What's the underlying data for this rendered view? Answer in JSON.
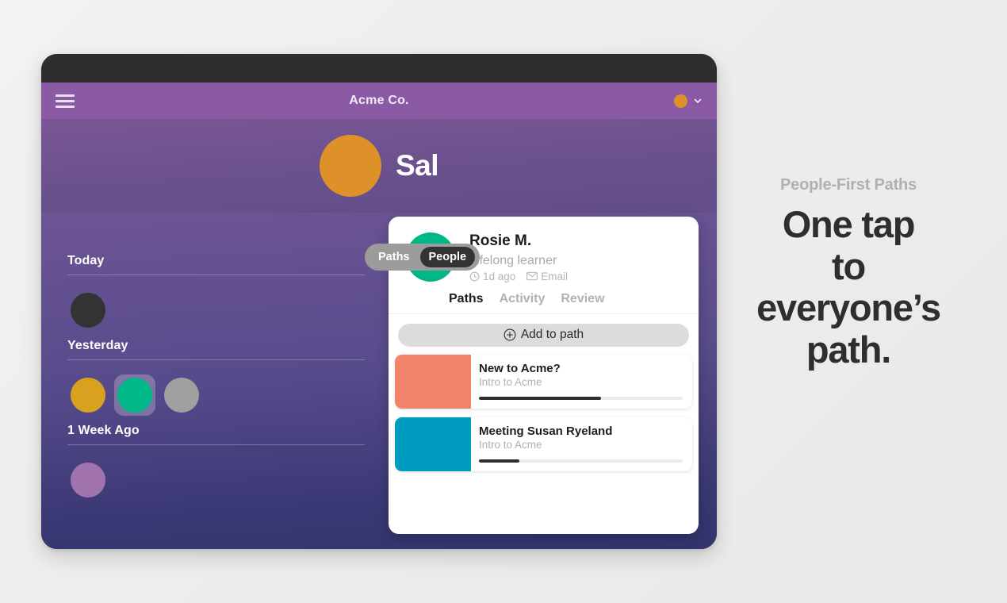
{
  "app": {
    "title": "Acme Co.",
    "menu_icon": "hamburger-icon",
    "account_avatar_color": "#df9129",
    "account_chevron_icon": "chevron-down-icon"
  },
  "hero": {
    "name": "Sal",
    "avatar_color": "#df9129"
  },
  "segmented": {
    "options": [
      {
        "label": "Paths",
        "active": false
      },
      {
        "label": "People",
        "active": true
      }
    ]
  },
  "timeline": {
    "groups": [
      {
        "title": "Today",
        "avatars": [
          {
            "color": "#333333",
            "selected": false
          }
        ]
      },
      {
        "title": "Yesterday",
        "avatars": [
          {
            "color": "#d9a11f",
            "selected": false
          },
          {
            "color": "#00b887",
            "selected": true
          },
          {
            "color": "#a0a0a0",
            "selected": false
          }
        ]
      },
      {
        "title": "1 Week Ago",
        "avatars": [
          {
            "color": "#a173ae",
            "selected": false
          }
        ]
      }
    ]
  },
  "detail": {
    "person": {
      "name": "Rosie M.",
      "role": "Lifelong learner",
      "avatar_color": "#00b887",
      "last_seen": "1d ago",
      "last_seen_icon": "clock-icon",
      "email_label": "Email",
      "email_icon": "envelope-icon"
    },
    "tabs": [
      {
        "label": "Paths",
        "active": true
      },
      {
        "label": "Activity",
        "active": false
      },
      {
        "label": "Review",
        "active": false
      }
    ],
    "add_button": {
      "label": "Add to path",
      "icon": "plus-circle-icon"
    },
    "paths": [
      {
        "title": "New to Acme?",
        "subtitle": "Intro to Acme",
        "thumb_color": "#f0836a",
        "progress": 60
      },
      {
        "title": "Meeting Susan Ryeland",
        "subtitle": "Intro to Acme",
        "thumb_color": "#019bc0",
        "progress": 20
      }
    ]
  },
  "marketing": {
    "eyebrow": "People-First Paths",
    "headline_line1": "One tap",
    "headline_line2": "to",
    "headline_line3": "everyone’s",
    "headline_line4": "path."
  }
}
